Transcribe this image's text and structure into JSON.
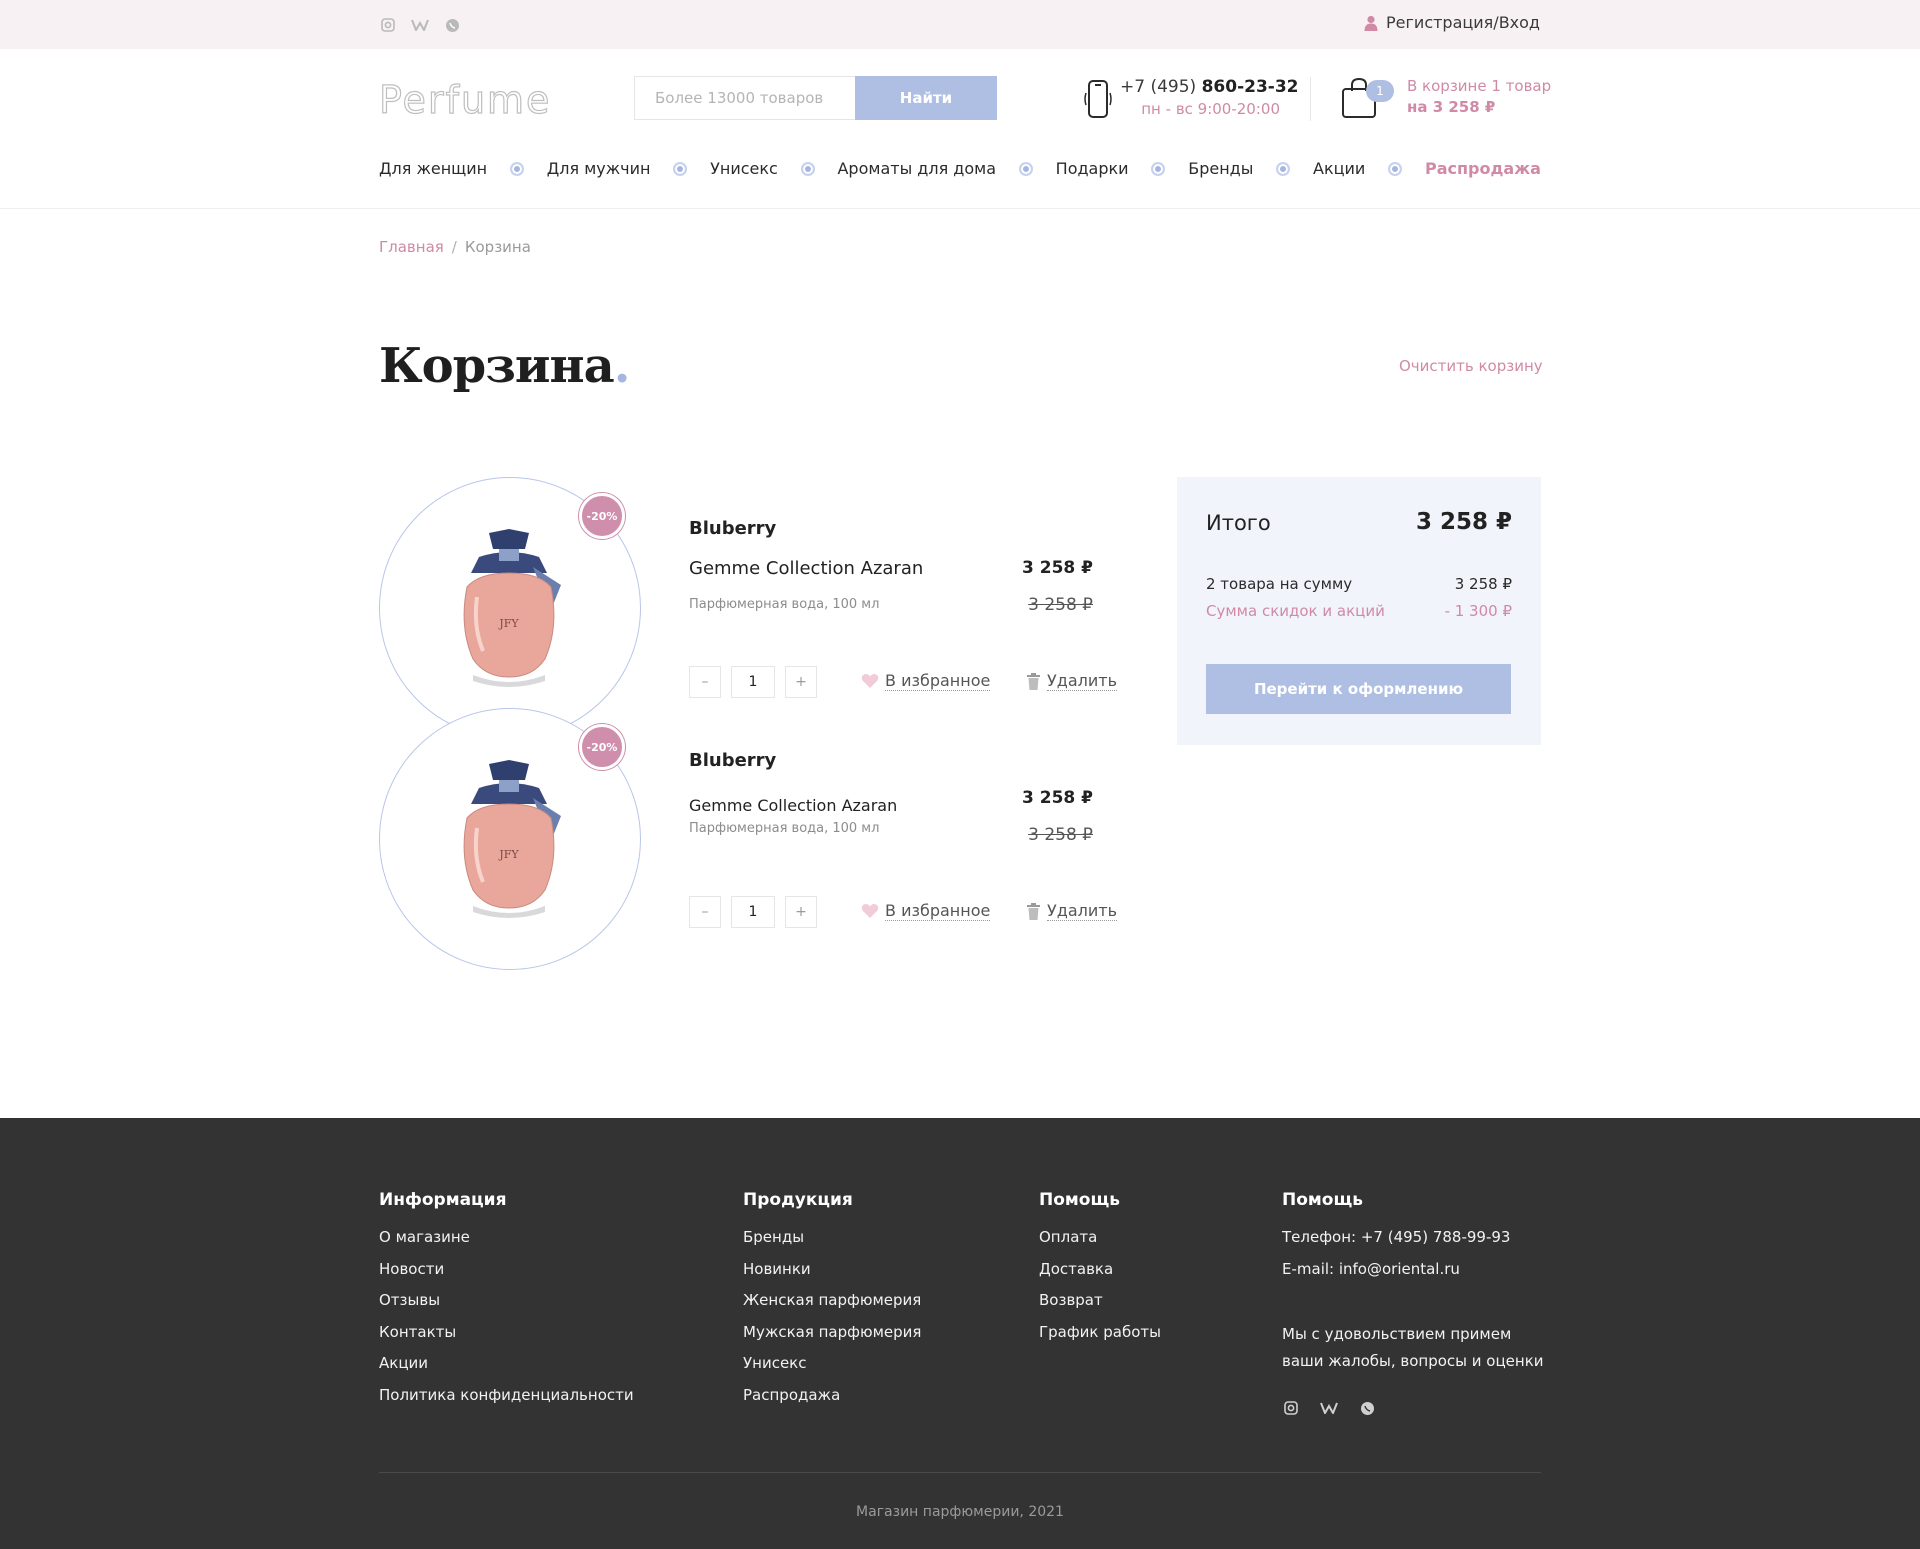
{
  "topbar": {
    "login": "Регистрация/Вход"
  },
  "header": {
    "logo_text": "Perfume",
    "search_placeholder": "Более 13000 товаров",
    "search_button": "Найти",
    "phone_prefix": "+7 (495) ",
    "phone_main": "860-23-32",
    "hours": "пн - вс 9:00-20:00",
    "cart_count": "1",
    "cart_line1": "В корзине 1 товар",
    "cart_line2": "на 3 258 ₽"
  },
  "nav": [
    "Для женщин",
    "Для мужчин",
    "Унисекс",
    "Ароматы для дома",
    "Подарки",
    "Бренды",
    "Акции",
    "Распродажа"
  ],
  "breadcrumb": {
    "home": "Главная",
    "sep": "/",
    "current": "Корзина"
  },
  "page": {
    "title": "Корзина",
    "title_dot": ".",
    "clear": "Очистить корзину"
  },
  "items": [
    {
      "badge": "-20%",
      "brand": "Bluberry",
      "name": "Gemme Collection Azaran",
      "desc": "Парфюмерная вода, 100 мл",
      "price": "3 258 ₽",
      "old_price": "3 258 ₽",
      "qty": "1",
      "minus": "–",
      "plus": "+",
      "favorite": "В избранное",
      "delete": "Удалить",
      "bottle_label": "JFY"
    },
    {
      "badge": "-20%",
      "brand": "Bluberry",
      "name": "Gemme Collection Azaran",
      "desc": "Парфюмерная вода, 100 мл",
      "price": "3 258 ₽",
      "old_price": "3 258 ₽",
      "qty": "1",
      "minus": "–",
      "plus": "+",
      "favorite": "В избранное",
      "delete": "Удалить",
      "bottle_label": "JFY"
    }
  ],
  "summary": {
    "total_label": "Итого",
    "total_value": "3 258 ₽",
    "items_label": "2 товара на сумму",
    "items_value": "3 258 ₽",
    "discount_label": "Сумма скидок и акций",
    "discount_value": "- 1 300 ₽",
    "checkout": "Перейти к оформлению"
  },
  "footer": {
    "col1": {
      "title": "Информация",
      "links": [
        "О магазине",
        "Новости",
        "Отзывы",
        "Контакты",
        "Акции",
        "Политика конфиденциальности"
      ]
    },
    "col2": {
      "title": "Продукция",
      "links": [
        "Бренды",
        "Новинки",
        "Женская парфюмерия",
        "Мужская парфюмерия",
        "Унисекс",
        "Распродажа"
      ]
    },
    "col3": {
      "title": "Помощь",
      "links": [
        "Оплата",
        "Доставка",
        "Возврат",
        "График работы"
      ]
    },
    "col4": {
      "title": "Помощь",
      "phone": "Телефон: +7 (495) 788-99-93",
      "email": "E-mail: info@oriental.ru",
      "note": "Мы с удовольствием примем ваши жалобы, вопросы и оценки"
    },
    "copyright": "Магазин парфюмерии, 2021"
  },
  "colors": {
    "accent_blue": "#afbfe3",
    "accent_pink": "#d08aa6",
    "footer_bg": "#333333"
  },
  "icons": [
    "instagram-icon",
    "vk-icon",
    "whatsapp-icon",
    "user-icon",
    "phone-icon",
    "cart-icon",
    "heart-icon",
    "trash-icon"
  ]
}
